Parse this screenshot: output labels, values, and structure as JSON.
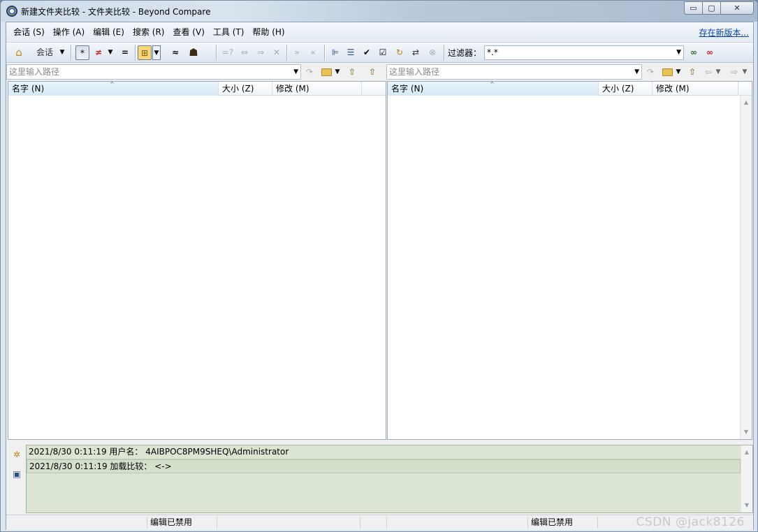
{
  "window": {
    "title": "新建文件夹比较 - 文件夹比较 - Beyond Compare",
    "min_glyph": "▭",
    "max_glyph": "▢",
    "close_glyph": "✕"
  },
  "menu": {
    "items": [
      "会话 (S)",
      "操作 (A)",
      "编辑 (E)",
      "搜索 (R)",
      "查看 (V)",
      "工具 (T)",
      "帮助 (H)"
    ],
    "update_link": "存在新版本..."
  },
  "toolbar": {
    "session_label": "会话",
    "filter_label": "过滤器：",
    "filter_value": "*.*",
    "glyphs": {
      "home": "⌂",
      "dropdown": "▼",
      "all": "*",
      "diff": "≠",
      "same": "=",
      "structure": "⊞",
      "minor": "≈",
      "person": "☗",
      "compare": "=?",
      "copy_right": "⇔",
      "copy": "⇒",
      "delete": "✕",
      "sync_right": "»",
      "sync_left": "«",
      "expand": "⊫",
      "collapse": "☰",
      "check": "✔",
      "check_all": "☑",
      "refresh": "↻",
      "swap": "⇄",
      "stop": "⊗",
      "glasses": "∞",
      "glasses_off": "∞"
    }
  },
  "paths": {
    "left_placeholder": "这里输入路径",
    "right_placeholder": "这里输入路径",
    "glyphs": {
      "dropdown": "▼",
      "go": "↷",
      "up": "⇧",
      "back": "⇦",
      "forward": "⇨"
    }
  },
  "left_pane": {
    "columns": [
      "名字 (N)",
      "大小 (Z)",
      "修改 (M)"
    ],
    "sort_glyph": "^"
  },
  "right_pane": {
    "columns": [
      "名字 (N)",
      "大小 (Z)",
      "修改 (M)"
    ],
    "sort_glyph": "^"
  },
  "log": {
    "icons": {
      "gear": "✲",
      "save": "▣"
    },
    "entries": [
      "2021/8/30 0:11:19  用户名： 4AIBPOC8PM9SHEQ\\Administrator",
      "2021/8/30 0:11:19  加载比较： <->"
    ],
    "scroll_up": "▲",
    "scroll_down": "▼"
  },
  "status": {
    "left": "编辑已禁用",
    "right": "编辑已禁用"
  },
  "watermark": "CSDN @jack8126",
  "colors": {
    "log_background": "#dbe5d3",
    "sorted_column": "#d6e9f7",
    "link": "#0645ad",
    "diff_red": "#d01c1c"
  }
}
